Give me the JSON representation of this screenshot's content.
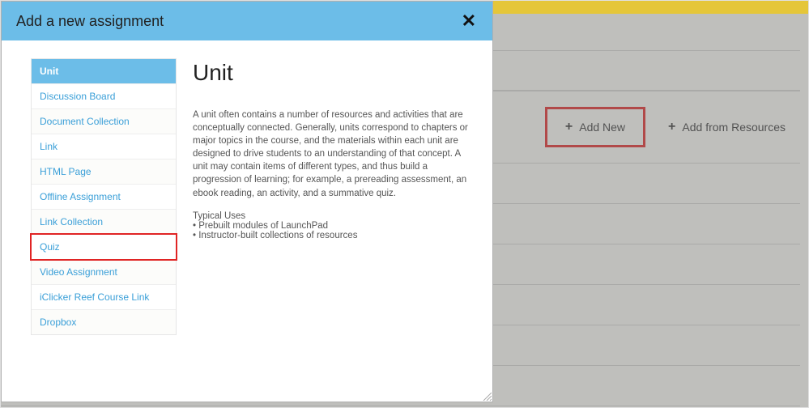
{
  "background": {
    "add_new_label": "Add New",
    "add_from_resources_label": "Add from Resources"
  },
  "modal": {
    "title": "Add a new assignment",
    "sidebar_items": [
      {
        "label": "Unit",
        "selected": true,
        "alt": false,
        "highlight": false
      },
      {
        "label": "Discussion Board",
        "selected": false,
        "alt": false,
        "highlight": false
      },
      {
        "label": "Document Collection",
        "selected": false,
        "alt": true,
        "highlight": false
      },
      {
        "label": "Link",
        "selected": false,
        "alt": false,
        "highlight": false
      },
      {
        "label": "HTML Page",
        "selected": false,
        "alt": true,
        "highlight": false
      },
      {
        "label": "Offline Assignment",
        "selected": false,
        "alt": false,
        "highlight": false
      },
      {
        "label": "Link Collection",
        "selected": false,
        "alt": true,
        "highlight": false
      },
      {
        "label": "Quiz",
        "selected": false,
        "alt": false,
        "highlight": true
      },
      {
        "label": "Video Assignment",
        "selected": false,
        "alt": true,
        "highlight": false
      },
      {
        "label": "iClicker Reef Course Link",
        "selected": false,
        "alt": false,
        "highlight": false
      },
      {
        "label": "Dropbox",
        "selected": false,
        "alt": true,
        "highlight": false
      }
    ],
    "detail": {
      "title": "Unit",
      "description": "A unit often contains a number of resources and activities that are conceptually connected. Generally, units correspond to chapters or major topics in the course, and the materials within each unit are designed to drive students to an understanding of that concept. A unit may contain items of different types, and thus build a progression of learning; for example, a prereading assessment, an ebook reading, an activity, and a summative quiz.",
      "typical_uses_heading": "Typical Uses",
      "uses": [
        "Prebuilt modules of LaunchPad",
        "Instructor-built collections of resources"
      ]
    }
  }
}
